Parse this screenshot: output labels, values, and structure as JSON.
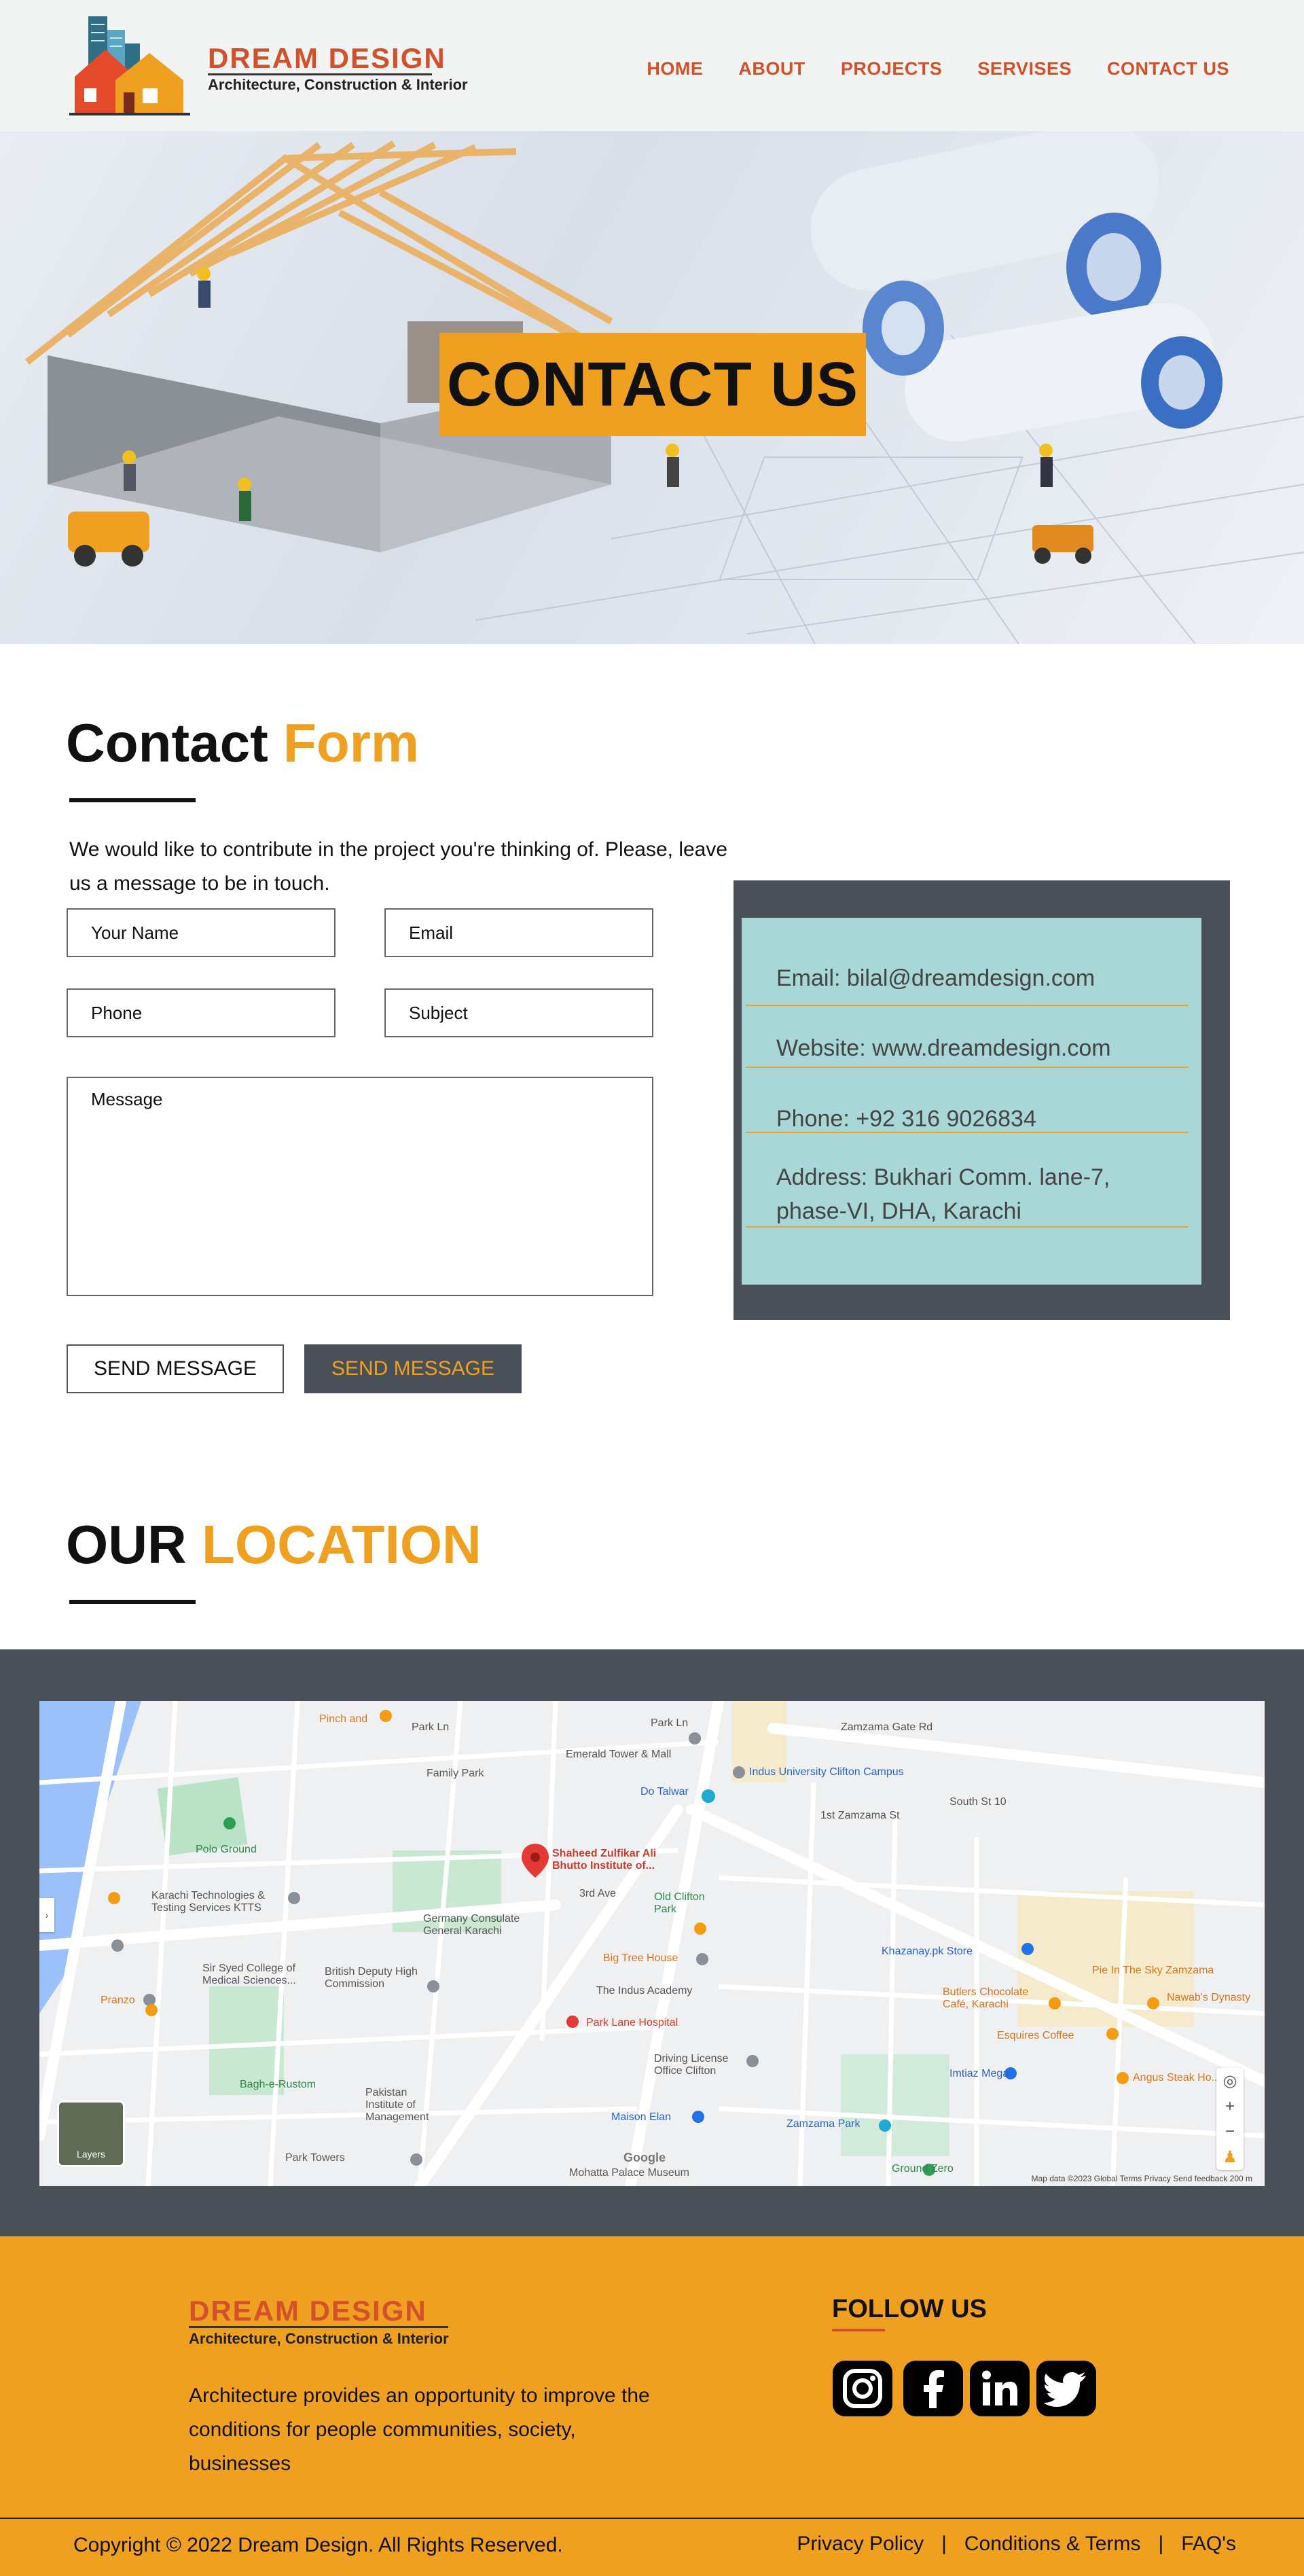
{
  "brand": {
    "name": "DREAM DESIGN",
    "tagline": "Architecture, Construction & Interior"
  },
  "nav": {
    "items": [
      "HOME",
      "ABOUT",
      "PROJECTS",
      "SERVISES",
      "CONTACT US"
    ]
  },
  "hero": {
    "title": "CONTACT US"
  },
  "contact_form": {
    "title_main": "Contact",
    "title_accent": "Form",
    "intro": "We would like to contribute in the project you're thinking of. Please, leave us a message to be in touch.",
    "name_placeholder": "Your Name",
    "email_placeholder": "Email",
    "phone_placeholder": "Phone",
    "subject_placeholder": "Subject",
    "message_placeholder": "Message",
    "send_button_1": "SEND MESSAGE",
    "send_button_2": "SEND MESSAGE"
  },
  "contact_info": {
    "email": "Email: bilal@dreamdesign.com",
    "website": "Website: www.dreamdesign.com",
    "phone": "Phone: +92 316 9026834",
    "address_line1": "Address: Bukhari Comm. lane-7,",
    "address_line2": "phase-VI, DHA, Karachi"
  },
  "location": {
    "title_main": "OUR",
    "title_accent": "LOCATION",
    "map_labels": {
      "pinch": "Pinch and",
      "park_ln": "Park Ln",
      "park_ln2": "Park Ln",
      "zamzama_gate": "Zamzama Gate Rd",
      "emerald": "Emerald Tower & Mall",
      "family_park": "Family Park",
      "indus": "Indus University Clifton Campus",
      "do_talwar": "Do Talwar",
      "zamzama_1st": "1st Zamzama St",
      "south_st": "South St 10",
      "polo": "Polo Ground",
      "szabist": "Shaheed Zulfikar Ali Bhutto Institute of...",
      "old_clifton": "Old Clifton Park",
      "karachi_tech": "Karachi Technologies & Testing Services KTTS",
      "germany": "Germany Consulate General Karachi",
      "third_ave": "3rd Ave",
      "big_tree": "Big Tree House",
      "khazanay": "Khazanay.pk Store",
      "pie_sky": "Pie In The Sky Zamzama",
      "nawabs": "Nawab's Dynasty",
      "sir_syed": "Sir Syed College of Medical Sciences...",
      "british": "British Deputy High Commission",
      "indus_academy": "The Indus Academy",
      "butlers": "Butlers Chocolate Café, Karachi",
      "esquires": "Esquires Coffee",
      "park_lane": "Park Lane Hospital",
      "imtiaz": "Imtiaz Mega",
      "angus": "Angus Steak Ho...",
      "pranzo": "Pranzo",
      "driving": "Driving License Office Clifton",
      "bagh": "Bagh-e-Rustom",
      "pakistan_inst": "Pakistan Institute of Management",
      "maison": "Maison Elan",
      "zamzama_park": "Zamzama Park",
      "park_towers": "Park Towers",
      "mohatta": "Mohatta Palace Museum",
      "ground_zero": "Ground Zero",
      "layers": "Layers",
      "google": "Google",
      "map_footer": "Map data ©2023   Global   Terms   Privacy   Send feedback   200 m"
    }
  },
  "footer": {
    "brand_name": "DREAM DESIGN",
    "brand_tagline": "Architecture, Construction & Interior",
    "description": "Architecture provides an opportunity to improve the conditions for people communities, society, businesses",
    "follow_title": "FOLLOW US",
    "socials": [
      "instagram-icon",
      "facebook-icon",
      "linkedin-icon",
      "twitter-icon"
    ],
    "copyright": "Copyright © 2022 Dream Design. All Rights Reserved.",
    "links": [
      "Privacy Policy",
      "Conditions & Terms",
      "FAQ's"
    ],
    "separator": "|"
  },
  "colors": {
    "accent_orange": "#f0a020",
    "brand_red": "#d2502a",
    "dark_slate": "#4a5058",
    "info_teal": "#a9d6d7"
  }
}
